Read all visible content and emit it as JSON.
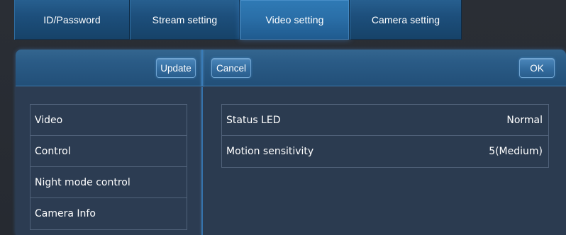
{
  "tabs": [
    {
      "label": "ID/Password"
    },
    {
      "label": "Stream setting"
    },
    {
      "label": "Video setting"
    },
    {
      "label": "Camera setting"
    }
  ],
  "toolbar": {
    "update_label": "Update",
    "cancel_label": "Cancel",
    "ok_label": "OK"
  },
  "sidebar": {
    "items": [
      {
        "label": "Video"
      },
      {
        "label": "Control"
      },
      {
        "label": "Night mode control"
      },
      {
        "label": "Camera Info"
      }
    ]
  },
  "settings": {
    "rows": [
      {
        "label": "Status LED",
        "value": "Normal"
      },
      {
        "label": "Motion sensitivity",
        "value": "5(Medium)"
      }
    ]
  },
  "colors": {
    "background": "#262a31",
    "tab": "#1d4f7c",
    "tab_active": "#2a6fa8",
    "toolbar": "#2a5b86",
    "panel": "#2c3c52",
    "border": "#51627a"
  }
}
